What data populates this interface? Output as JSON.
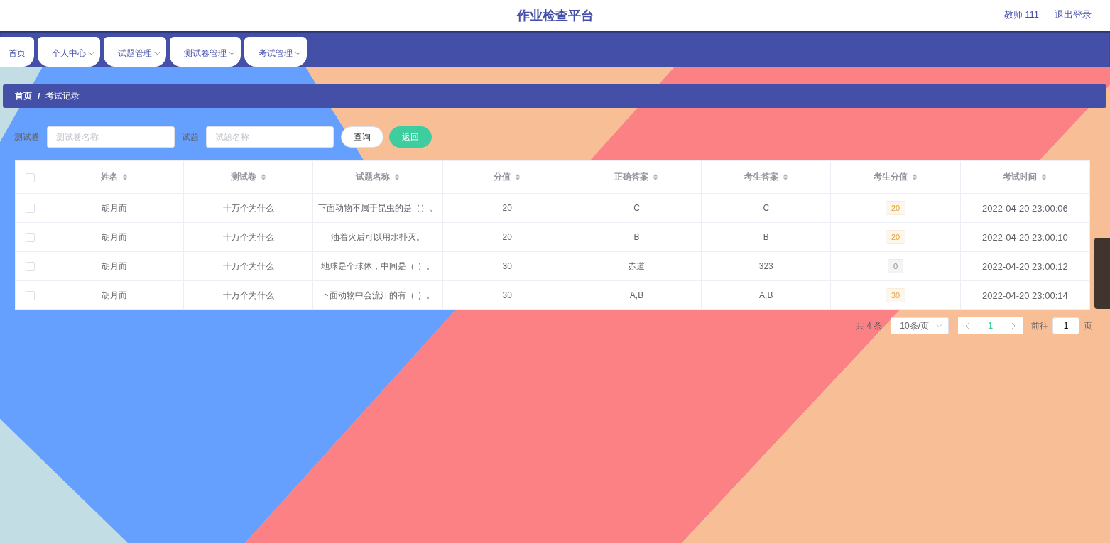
{
  "header": {
    "title": "作业检查平台",
    "user": "教师 111",
    "logout": "退出登录"
  },
  "nav": [
    {
      "label": "首页",
      "dropdown": false
    },
    {
      "label": "个人中心",
      "dropdown": true
    },
    {
      "label": "试题管理",
      "dropdown": true
    },
    {
      "label": "测试卷管理",
      "dropdown": true
    },
    {
      "label": "考试管理",
      "dropdown": true
    }
  ],
  "breadcrumb": {
    "items": [
      "首页",
      "考试记录"
    ],
    "separator": "/"
  },
  "search": [
    {
      "label": "测试卷",
      "placeholder": "测试卷名称"
    },
    {
      "label": "试题",
      "placeholder": "试题名称"
    }
  ],
  "buttons": [
    {
      "label": "查询",
      "kind": "default"
    },
    {
      "label": "返回",
      "kind": "primary"
    }
  ],
  "table": {
    "select_all_checked": false,
    "columns": [
      "姓名",
      "测试卷",
      "试题名称",
      "分值",
      "正确答案",
      "考生答案",
      "考生分值",
      "考试时间"
    ],
    "rows": [
      {
        "checked": false,
        "cells": [
          "胡月而",
          "十万个为什么",
          "下面动物不属于昆虫的是（）。",
          "20",
          "C",
          "C"
        ],
        "score": {
          "text": "20",
          "kind": "warning"
        },
        "time": "2022-04-20 23:00:06"
      },
      {
        "checked": false,
        "cells": [
          "胡月而",
          "十万个为什么",
          "油着火后可以用水扑灭。",
          "20",
          "B",
          "B"
        ],
        "score": {
          "text": "20",
          "kind": "warning"
        },
        "time": "2022-04-20 23:00:10"
      },
      {
        "checked": false,
        "cells": [
          "胡月而",
          "十万个为什么",
          "地球是个球体，中间是（ ）。",
          "30",
          "赤道",
          "323"
        ],
        "score": {
          "text": "0",
          "kind": "info"
        },
        "time": "2022-04-20 23:00:12"
      },
      {
        "checked": false,
        "cells": [
          "胡月而",
          "十万个为什么",
          "下面动物中会流汗的有（ ）。",
          "30",
          "A,B",
          "A,B"
        ],
        "score": {
          "text": "30",
          "kind": "warning"
        },
        "time": "2022-04-20 23:00:14"
      }
    ]
  },
  "pagination": {
    "total": "共 4 条",
    "page_size": "10条/页",
    "pages": [
      {
        "label": "1",
        "selected": true
      }
    ],
    "goto_label": "前往",
    "goto_value": "1",
    "goto_suffix": "页"
  }
}
